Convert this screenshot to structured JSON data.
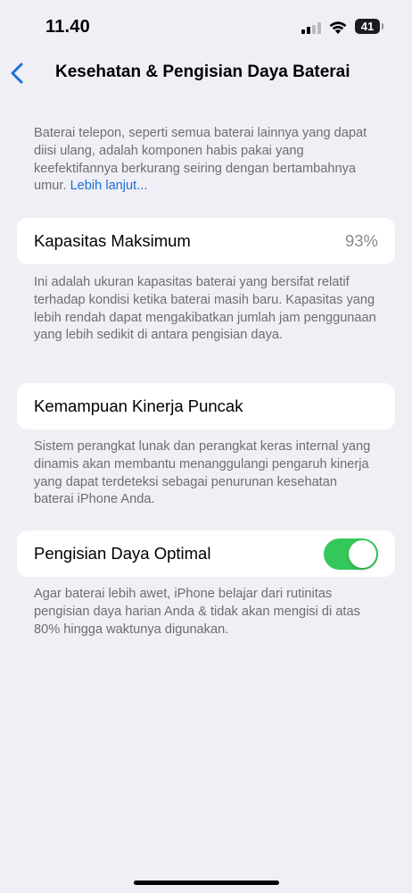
{
  "status_bar": {
    "time": "11.40",
    "battery_level": "41",
    "icons": [
      "cellular-signal-icon",
      "wifi-icon",
      "battery-icon"
    ]
  },
  "nav": {
    "back_icon": "chevron-left-icon",
    "title": "Kesehatan & Pengisian Daya Baterai"
  },
  "intro": {
    "text": "Baterai telepon, seperti semua baterai lainnya yang dapat diisi ulang, adalah komponen habis pakai yang keefektifannya berkurang seiring dengan bertambahnya umur.",
    "link": "Lebih lanjut..."
  },
  "max_capacity": {
    "label": "Kapasitas Maksimum",
    "value": "93%",
    "description": "Ini adalah ukuran kapasitas baterai yang bersifat relatif terhadap kondisi ketika baterai masih baru. Kapasitas yang lebih rendah dapat mengakibatkan jumlah jam penggunaan yang lebih sedikit di antara pengisian daya."
  },
  "peak_performance": {
    "label": "Kemampuan Kinerja Puncak",
    "description": "Sistem perangkat lunak dan perangkat keras internal yang dinamis akan membantu menanggulangi pengaruh kinerja yang dapat terdeteksi sebagai penurunan kesehatan baterai iPhone Anda."
  },
  "optimized_charging": {
    "label": "Pengisian Daya Optimal",
    "enabled": true,
    "description": "Agar baterai lebih awet, iPhone belajar dari rutinitas pengisian daya harian Anda & tidak akan mengisi di atas 80% hingga waktunya digunakan."
  },
  "colors": {
    "background": "#f0eff6",
    "accent_link": "#1d6fd6",
    "toggle_on": "#34c759",
    "secondary_text": "#6d6d72"
  }
}
